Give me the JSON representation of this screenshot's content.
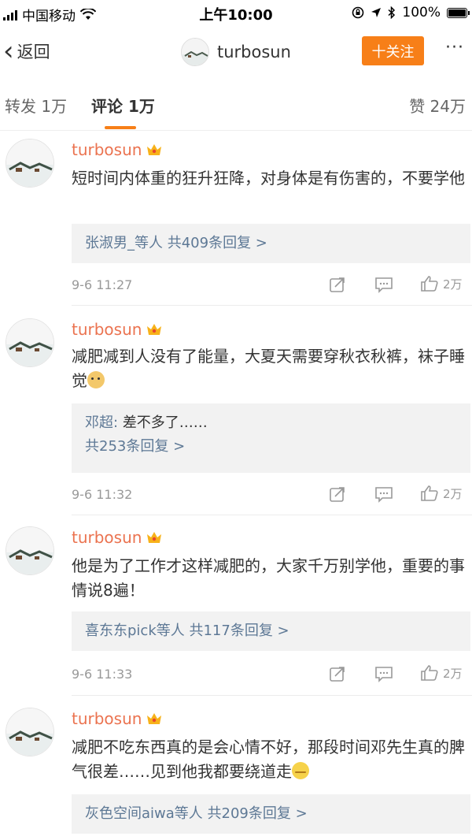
{
  "status_bar": {
    "carrier": "中国移动",
    "time": "上午10:00",
    "battery": "100%"
  },
  "nav": {
    "back_label": "返回",
    "title": "turbosun",
    "follow_label": "十关注",
    "more_label": "···"
  },
  "tabs": {
    "repost": "转发 1万",
    "comments": "评论 1万",
    "likes": "赞 24万"
  },
  "comments": [
    {
      "user": "turbosun",
      "text": "短时间内体重的狂升狂降，对身体是有伤害的，不要学他",
      "replies_text": "张淑男_等人 共409条回复 >",
      "time": "9-6 11:27",
      "likes": "2万"
    },
    {
      "user": "turbosun",
      "text": "减肥减到人没有了能量，大夏天需要穿秋衣秋裤，袜子睡觉",
      "reply_name": "邓超:",
      "reply_text": "差不多了……",
      "replies_text": "共253条回复 >",
      "time": "9-6 11:32",
      "likes": "2万"
    },
    {
      "user": "turbosun",
      "text": "他是为了工作才这样减肥的，大家千万别学他，重要的事情说8遍！",
      "replies_text": "喜东东pick等人 共117条回复 >",
      "time": "9-6 11:33",
      "likes": "2万"
    },
    {
      "user": "turbosun",
      "text": "减肥不吃东西真的是会心情不好，那段时间邓先生真的脾气很差……见到他我都要绕道走",
      "replies_text": "灰色空间aiwa等人 共209条回复 >"
    }
  ],
  "colors": {
    "accent": "#f77f18",
    "username": "#eb7350",
    "reply_link": "#5d7895"
  }
}
